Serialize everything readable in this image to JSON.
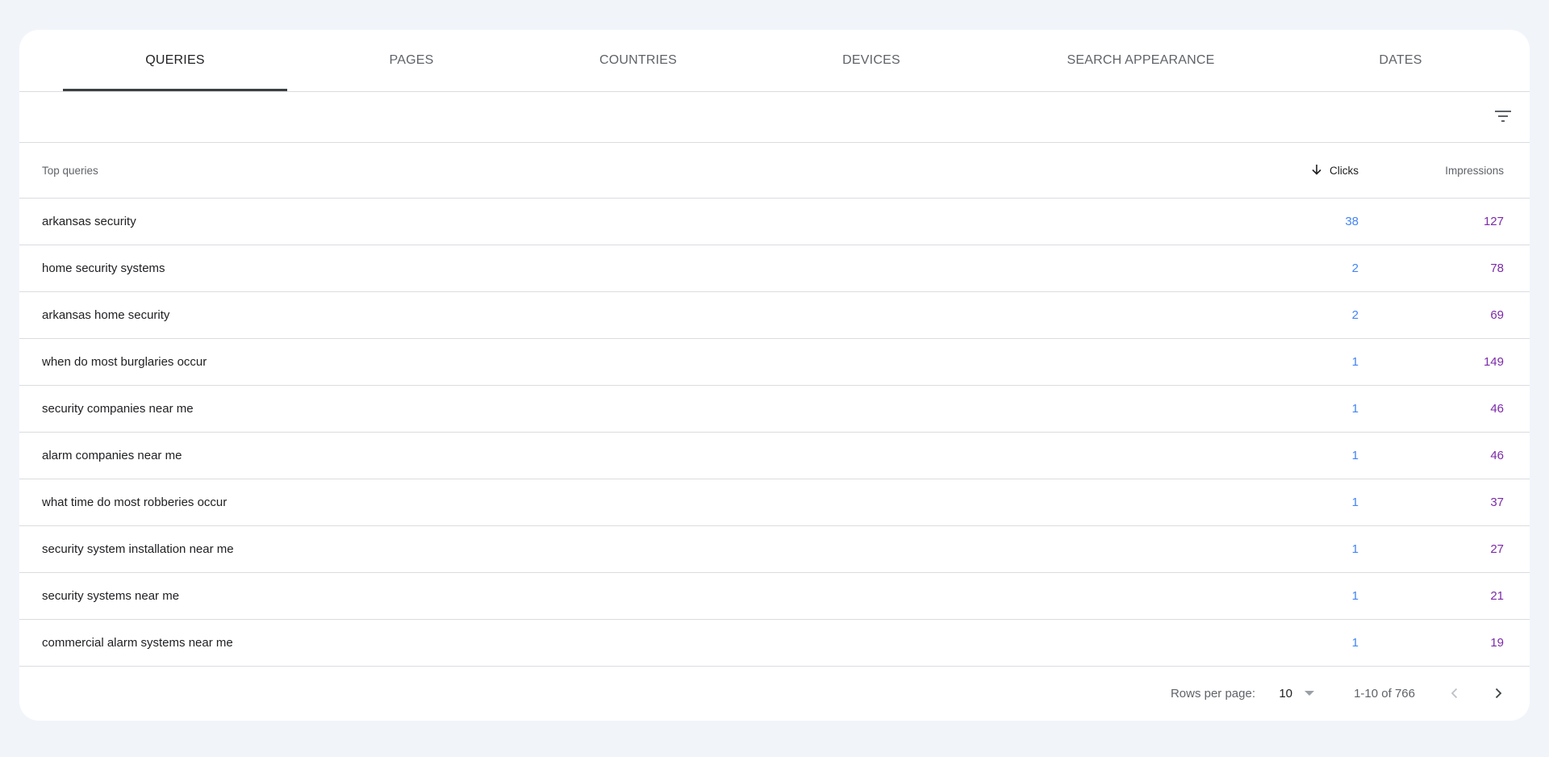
{
  "tabs": [
    {
      "label": "QUERIES",
      "active": true
    },
    {
      "label": "PAGES"
    },
    {
      "label": "COUNTRIES"
    },
    {
      "label": "DEVICES"
    },
    {
      "label": "SEARCH APPEARANCE"
    },
    {
      "label": "DATES"
    }
  ],
  "toolbar": {
    "filter_icon": "filter-list-icon"
  },
  "table": {
    "headers": {
      "query": "Top queries",
      "clicks": "Clicks",
      "impressions": "Impressions"
    },
    "sort_icon": "arrow-down-icon",
    "rows": [
      {
        "query": "arkansas security",
        "clicks": "38",
        "impressions": "127"
      },
      {
        "query": "home security systems",
        "clicks": "2",
        "impressions": "78"
      },
      {
        "query": "arkansas home security",
        "clicks": "2",
        "impressions": "69"
      },
      {
        "query": "when do most burglaries occur",
        "clicks": "1",
        "impressions": "149"
      },
      {
        "query": "security companies near me",
        "clicks": "1",
        "impressions": "46"
      },
      {
        "query": "alarm companies near me",
        "clicks": "1",
        "impressions": "46"
      },
      {
        "query": "what time do most robberies occur",
        "clicks": "1",
        "impressions": "37"
      },
      {
        "query": "security system installation near me",
        "clicks": "1",
        "impressions": "27"
      },
      {
        "query": "security systems near me",
        "clicks": "1",
        "impressions": "21"
      },
      {
        "query": "commercial alarm systems near me",
        "clicks": "1",
        "impressions": "19"
      }
    ]
  },
  "pagination": {
    "rows_per_page_label": "Rows per page:",
    "rows_per_page_value": "10",
    "range": "1-10 of 766"
  },
  "colors": {
    "clicks": "#4285f4",
    "impressions": "#7b2aa8",
    "background": "#f1f5fa"
  }
}
